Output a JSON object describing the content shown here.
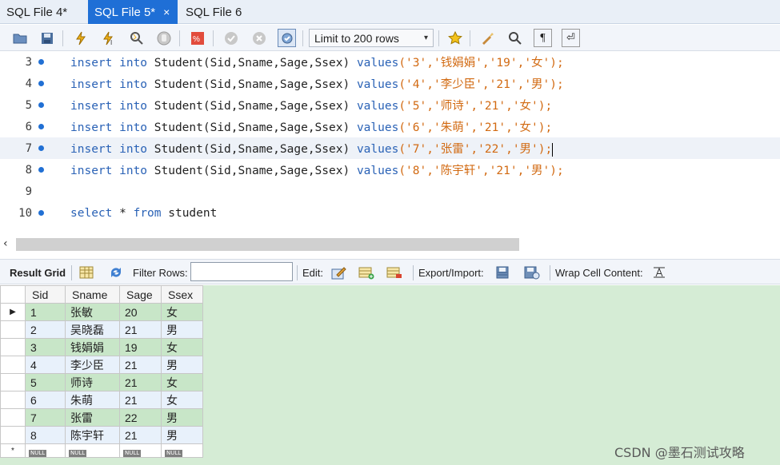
{
  "tabs": [
    {
      "label": "SQL File 4*",
      "active": false
    },
    {
      "label": "SQL File 5*",
      "active": true,
      "close": "×"
    },
    {
      "label": "SQL File 6",
      "active": false
    }
  ],
  "toolbar": {
    "icons": [
      "open-folder-icon",
      "save-icon",
      "execute-icon",
      "execute-current-icon",
      "explain-icon",
      "stop-icon",
      "toggle-error-icon",
      "commit-icon",
      "rollback-icon",
      "autocommit-icon",
      "bookmark-star-icon",
      "beautify-icon",
      "find-icon",
      "invisible-chars-icon",
      "wrap-icon"
    ],
    "limit_label": "Limit to 200 rows",
    "limit_arrow": "▾"
  },
  "editor": {
    "lines": [
      {
        "num": "3",
        "kw1": "insert into",
        "table": " Student(Sid,Sname,Sage,Ssex) ",
        "kw2": "values",
        "args": "('3','钱娟娟','19','女');"
      },
      {
        "num": "4",
        "kw1": "insert into",
        "table": " Student(Sid,Sname,Sage,Ssex) ",
        "kw2": "values",
        "args": "('4','李少臣','21','男');"
      },
      {
        "num": "5",
        "kw1": "insert into",
        "table": " Student(Sid,Sname,Sage,Ssex) ",
        "kw2": "values",
        "args": "('5','师诗','21','女');"
      },
      {
        "num": "6",
        "kw1": "insert into",
        "table": " Student(Sid,Sname,Sage,Ssex) ",
        "kw2": "values",
        "args": "('6','朱萌','21','女');"
      },
      {
        "num": "7",
        "kw1": "insert into",
        "table": " Student(Sid,Sname,Sage,Ssex) ",
        "kw2": "values",
        "args": "('7','张雷','22','男');"
      },
      {
        "num": "8",
        "kw1": "insert into",
        "table": " Student(Sid,Sname,Sage,Ssex) ",
        "kw2": "values",
        "args": "('8','陈宇轩','21','男');"
      },
      {
        "num": "9"
      },
      {
        "num": "10",
        "kw1": "select",
        "star": " * ",
        "kw2": "from",
        "tail": " student"
      }
    ]
  },
  "scroll": {
    "left_arrow": "‹"
  },
  "result_toolbar": {
    "result_grid": "Result Grid",
    "filter_rows": "Filter Rows:",
    "filter_value": "",
    "edit": "Edit:",
    "export_import": "Export/Import:",
    "wrap": "Wrap Cell Content:"
  },
  "grid": {
    "columns": [
      "Sid",
      "Sname",
      "Sage",
      "Ssex"
    ],
    "rows": [
      [
        "1",
        "张敏",
        "20",
        "女"
      ],
      [
        "2",
        "吴晓磊",
        "21",
        "男"
      ],
      [
        "3",
        "钱娟娟",
        "19",
        "女"
      ],
      [
        "4",
        "李少臣",
        "21",
        "男"
      ],
      [
        "5",
        "师诗",
        "21",
        "女"
      ],
      [
        "6",
        "朱萌",
        "21",
        "女"
      ],
      [
        "7",
        "张雷",
        "22",
        "男"
      ],
      [
        "8",
        "陈宇轩",
        "21",
        "男"
      ]
    ],
    "null_label": "NULL",
    "current_marker": "▶",
    "new_marker": "*"
  },
  "watermark": "CSDN @墨石测试攻略",
  "colors": {
    "accent": "#1f6fd6",
    "keyword": "#2a62b6",
    "string": "#d26a12",
    "grid_bg": "#d5ecd5"
  }
}
